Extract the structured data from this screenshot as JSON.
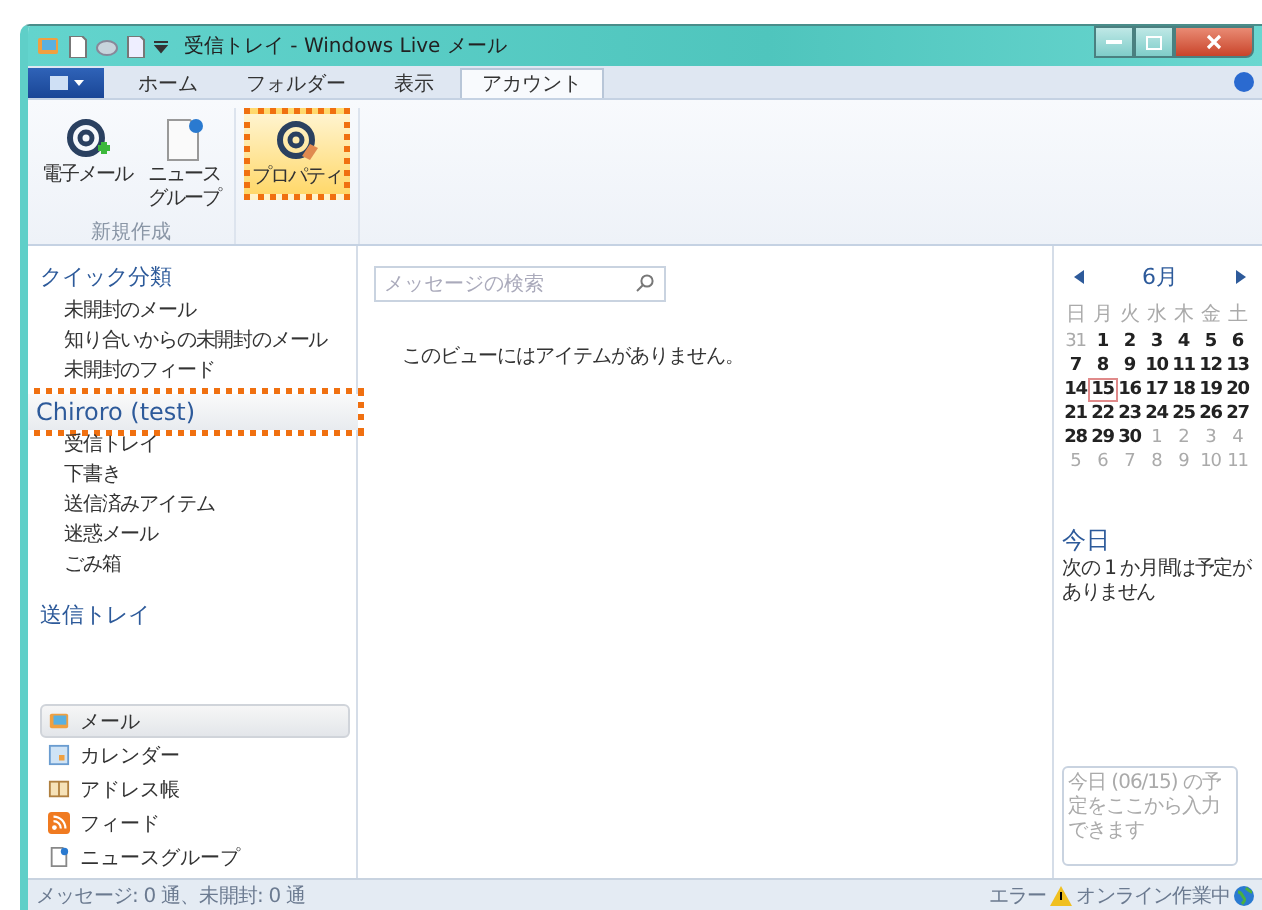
{
  "window": {
    "title": "受信トレイ - Windows Live メール"
  },
  "ribbon_tabs": [
    {
      "label": "ホーム",
      "selected": false
    },
    {
      "label": "フォルダー",
      "selected": false
    },
    {
      "label": "表示",
      "selected": false
    },
    {
      "label": "アカウント",
      "selected": true
    }
  ],
  "ribbon_groups": [
    {
      "label": "新規作成",
      "buttons": [
        {
          "kind": "email",
          "label": "電子メール",
          "highlighted": false
        },
        {
          "kind": "newsgroup",
          "label_lines": [
            "ニュース",
            "グループ"
          ],
          "highlighted": false
        }
      ]
    },
    {
      "buttons": [
        {
          "kind": "properties",
          "label": "プロパティ",
          "highlighted": true
        }
      ]
    }
  ],
  "quick_views": {
    "title": "クイック分類",
    "items": [
      "未開封のメール",
      "知り合いからの未開封のメール",
      "未開封のフィード"
    ]
  },
  "account": {
    "name": "Chiroro (test)",
    "highlighted": true,
    "folders": [
      "受信トレイ",
      "下書き",
      "送信済みアイテム",
      "迷惑メール",
      "ごみ箱"
    ]
  },
  "outbox": "送信トレイ",
  "nav": [
    {
      "kind": "mail",
      "label": "メール",
      "selected": true
    },
    {
      "kind": "calendar",
      "label": "カレンダー",
      "selected": false
    },
    {
      "kind": "contacts",
      "label": "アドレス帳",
      "selected": false
    },
    {
      "kind": "feed",
      "label": "フィード",
      "selected": false
    },
    {
      "kind": "newsgroup",
      "label": "ニュースグループ",
      "selected": false
    }
  ],
  "message_list": {
    "search_placeholder": "メッセージの検索",
    "empty_text": "このビューにはアイテムがありません。"
  },
  "calendar": {
    "month": "6月",
    "weekdays": [
      "日",
      "月",
      "火",
      "水",
      "木",
      "金",
      "土"
    ],
    "weeks": [
      [
        {
          "day": "31",
          "other_month": true,
          "today": false
        },
        {
          "day": "1",
          "other_month": false,
          "today": false
        },
        {
          "day": "2",
          "other_month": false,
          "today": false
        },
        {
          "day": "3",
          "other_month": false,
          "today": false
        },
        {
          "day": "4",
          "other_month": false,
          "today": false
        },
        {
          "day": "5",
          "other_month": false,
          "today": false
        },
        {
          "day": "6",
          "other_month": false,
          "today": false
        }
      ],
      [
        {
          "day": "7",
          "other_month": false,
          "today": false
        },
        {
          "day": "8",
          "other_month": false,
          "today": false
        },
        {
          "day": "9",
          "other_month": false,
          "today": false
        },
        {
          "day": "10",
          "other_month": false,
          "today": false
        },
        {
          "day": "11",
          "other_month": false,
          "today": false
        },
        {
          "day": "12",
          "other_month": false,
          "today": false
        },
        {
          "day": "13",
          "other_month": false,
          "today": false
        }
      ],
      [
        {
          "day": "14",
          "other_month": false,
          "today": false
        },
        {
          "day": "15",
          "other_month": false,
          "today": true
        },
        {
          "day": "16",
          "other_month": false,
          "today": false
        },
        {
          "day": "17",
          "other_month": false,
          "today": false
        },
        {
          "day": "18",
          "other_month": false,
          "today": false
        },
        {
          "day": "19",
          "other_month": false,
          "today": false
        },
        {
          "day": "20",
          "other_month": false,
          "today": false
        }
      ],
      [
        {
          "day": "21",
          "other_month": false,
          "today": false
        },
        {
          "day": "22",
          "other_month": false,
          "today": false
        },
        {
          "day": "23",
          "other_month": false,
          "today": false
        },
        {
          "day": "24",
          "other_month": false,
          "today": false
        },
        {
          "day": "25",
          "other_month": false,
          "today": false
        },
        {
          "day": "26",
          "other_month": false,
          "today": false
        },
        {
          "day": "27",
          "other_month": false,
          "today": false
        }
      ],
      [
        {
          "day": "28",
          "other_month": false,
          "today": false
        },
        {
          "day": "29",
          "other_month": false,
          "today": false
        },
        {
          "day": "30",
          "other_month": false,
          "today": false
        },
        {
          "day": "1",
          "other_month": true,
          "today": false
        },
        {
          "day": "2",
          "other_month": true,
          "today": false
        },
        {
          "day": "3",
          "other_month": true,
          "today": false
        },
        {
          "day": "4",
          "other_month": true,
          "today": false
        }
      ],
      [
        {
          "day": "5",
          "other_month": true,
          "today": false
        },
        {
          "day": "6",
          "other_month": true,
          "today": false
        },
        {
          "day": "7",
          "other_month": true,
          "today": false
        },
        {
          "day": "8",
          "other_month": true,
          "today": false
        },
        {
          "day": "9",
          "other_month": true,
          "today": false
        },
        {
          "day": "10",
          "other_month": true,
          "today": false
        },
        {
          "day": "11",
          "other_month": true,
          "today": false
        }
      ]
    ]
  },
  "today": {
    "title": "今日",
    "text_lines": [
      "次の 1 か月間は予定が",
      "ありません"
    ],
    "input_placeholder": "今日 (06/15) の予定をここから入力できます"
  },
  "status_bar": {
    "left": "メッセージ: 0 通、未開封: 0 通",
    "error": "エラー",
    "online": "オンライン作業中"
  }
}
